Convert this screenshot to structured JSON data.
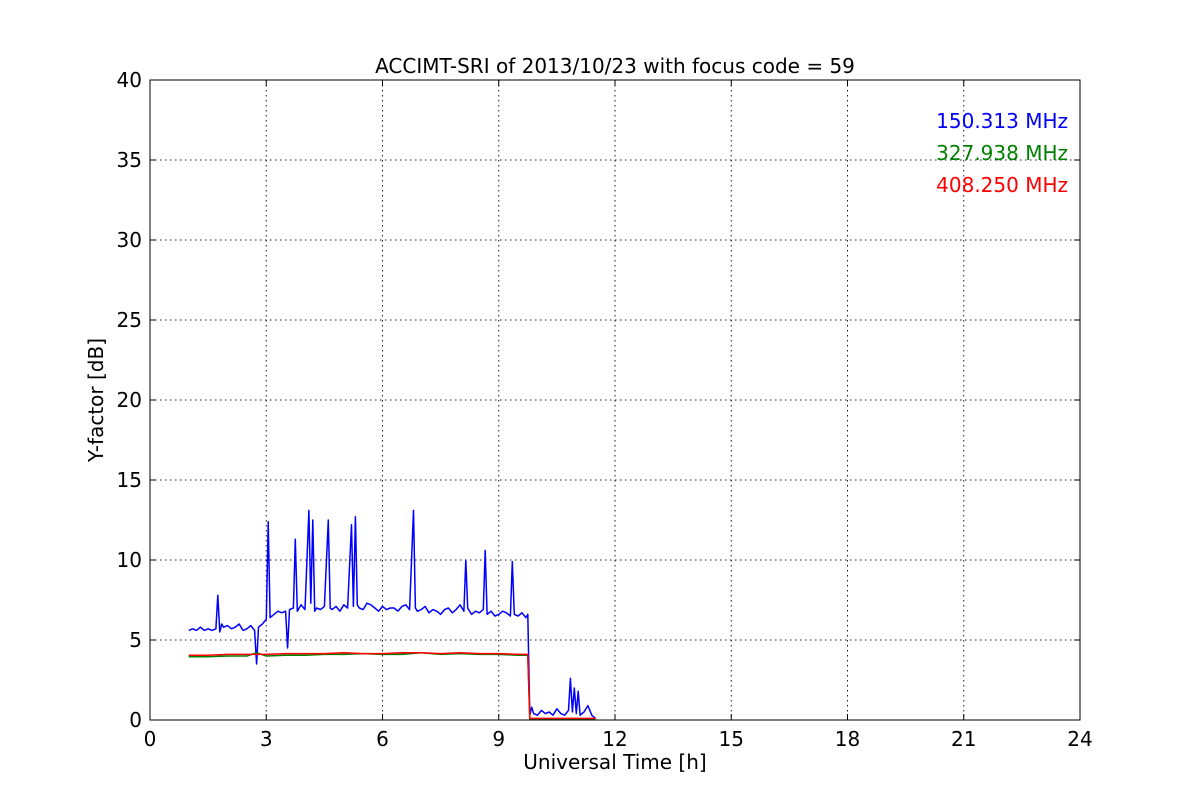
{
  "chart_data": {
    "type": "line",
    "title": "ACCIMT-SRI of 2013/10/23 with focus code = 59",
    "xlabel": "Universal Time [h]",
    "ylabel": "Y-factor [dB]",
    "xlim": [
      0,
      24
    ],
    "ylim": [
      0,
      40
    ],
    "xticks": [
      0,
      3,
      6,
      9,
      12,
      15,
      18,
      21,
      24
    ],
    "yticks": [
      0,
      5,
      10,
      15,
      20,
      25,
      30,
      35,
      40
    ],
    "grid": true,
    "legend_position": "top-right",
    "series": [
      {
        "name": "150.313 MHz",
        "color": "#0000ff",
        "x": [
          1.0,
          1.1,
          1.2,
          1.3,
          1.4,
          1.5,
          1.6,
          1.7,
          1.75,
          1.8,
          1.85,
          1.9,
          2.0,
          2.1,
          2.2,
          2.3,
          2.4,
          2.5,
          2.6,
          2.7,
          2.75,
          2.8,
          2.9,
          3.0,
          3.05,
          3.1,
          3.2,
          3.3,
          3.4,
          3.5,
          3.55,
          3.6,
          3.7,
          3.75,
          3.8,
          3.9,
          4.0,
          4.1,
          4.15,
          4.2,
          4.25,
          4.3,
          4.4,
          4.5,
          4.6,
          4.65,
          4.7,
          4.8,
          4.9,
          5.0,
          5.1,
          5.2,
          5.25,
          5.3,
          5.35,
          5.4,
          5.5,
          5.6,
          5.7,
          5.8,
          5.9,
          6.0,
          6.1,
          6.2,
          6.3,
          6.4,
          6.5,
          6.6,
          6.7,
          6.8,
          6.85,
          6.9,
          7.0,
          7.1,
          7.2,
          7.3,
          7.4,
          7.5,
          7.6,
          7.7,
          7.8,
          7.9,
          8.0,
          8.1,
          8.15,
          8.2,
          8.3,
          8.4,
          8.5,
          8.6,
          8.65,
          8.7,
          8.8,
          8.9,
          9.0,
          9.1,
          9.2,
          9.3,
          9.35,
          9.4,
          9.5,
          9.6,
          9.7,
          9.75,
          9.8,
          9.85,
          9.9,
          10.0,
          10.1,
          10.2,
          10.3,
          10.4,
          10.5,
          10.6,
          10.7,
          10.8,
          10.85,
          10.9,
          10.95,
          11.0,
          11.05,
          11.1,
          11.2,
          11.3,
          11.4,
          11.5
        ],
        "values": [
          5.6,
          5.7,
          5.6,
          5.8,
          5.6,
          5.7,
          5.6,
          5.7,
          7.8,
          5.5,
          6.0,
          5.8,
          5.9,
          5.7,
          5.8,
          6.0,
          5.6,
          5.7,
          5.9,
          5.6,
          3.5,
          5.8,
          6.0,
          6.3,
          12.4,
          6.4,
          6.6,
          6.8,
          6.7,
          6.8,
          4.5,
          6.9,
          7.0,
          11.3,
          6.8,
          7.2,
          6.9,
          13.1,
          7.3,
          12.5,
          6.8,
          7.0,
          6.9,
          7.1,
          12.5,
          7.0,
          6.9,
          7.1,
          6.8,
          7.2,
          7.0,
          12.2,
          7.1,
          12.7,
          7.2,
          7.0,
          6.9,
          7.3,
          7.2,
          7.0,
          6.8,
          7.1,
          6.9,
          7.0,
          7.0,
          6.8,
          7.1,
          7.2,
          6.9,
          13.1,
          7.0,
          6.8,
          6.9,
          7.1,
          6.7,
          6.9,
          6.8,
          6.6,
          6.9,
          7.0,
          6.7,
          6.9,
          7.2,
          6.8,
          10.0,
          7.0,
          6.6,
          6.8,
          6.7,
          6.9,
          10.6,
          6.6,
          6.8,
          6.5,
          6.6,
          6.8,
          6.7,
          6.5,
          9.9,
          6.6,
          6.5,
          6.7,
          6.4,
          6.6,
          0.3,
          0.8,
          0.4,
          0.3,
          0.6,
          0.4,
          0.5,
          0.3,
          0.7,
          0.4,
          0.3,
          0.6,
          2.6,
          0.5,
          2.0,
          0.4,
          1.8,
          0.3,
          0.5,
          0.9,
          0.3,
          0.1
        ]
      },
      {
        "name": "327.938 MHz",
        "color": "#008000",
        "x": [
          1.0,
          1.5,
          2.0,
          2.5,
          2.75,
          3.0,
          3.5,
          4.0,
          4.5,
          5.0,
          5.5,
          6.0,
          6.5,
          7.0,
          7.5,
          8.0,
          8.5,
          9.0,
          9.5,
          9.75,
          9.8,
          10.0,
          10.5,
          11.0,
          11.5
        ],
        "values": [
          3.95,
          3.95,
          4.0,
          4.0,
          4.2,
          4.0,
          4.05,
          4.05,
          4.1,
          4.1,
          4.15,
          4.1,
          4.1,
          4.2,
          4.1,
          4.15,
          4.1,
          4.1,
          4.05,
          4.05,
          0.05,
          0.05,
          0.05,
          0.05,
          0.05
        ]
      },
      {
        "name": "408.250 MHz",
        "color": "#ff0000",
        "x": [
          1.0,
          1.5,
          2.0,
          2.5,
          3.0,
          3.5,
          4.0,
          4.5,
          5.0,
          5.5,
          6.0,
          6.5,
          7.0,
          7.5,
          8.0,
          8.5,
          9.0,
          9.5,
          9.75,
          9.8,
          10.0,
          10.5,
          11.0,
          11.5
        ],
        "values": [
          4.05,
          4.05,
          4.1,
          4.1,
          4.1,
          4.15,
          4.15,
          4.15,
          4.2,
          4.15,
          4.15,
          4.2,
          4.2,
          4.15,
          4.2,
          4.15,
          4.15,
          4.1,
          4.1,
          0.1,
          0.1,
          0.1,
          0.1,
          0.1
        ]
      }
    ]
  }
}
